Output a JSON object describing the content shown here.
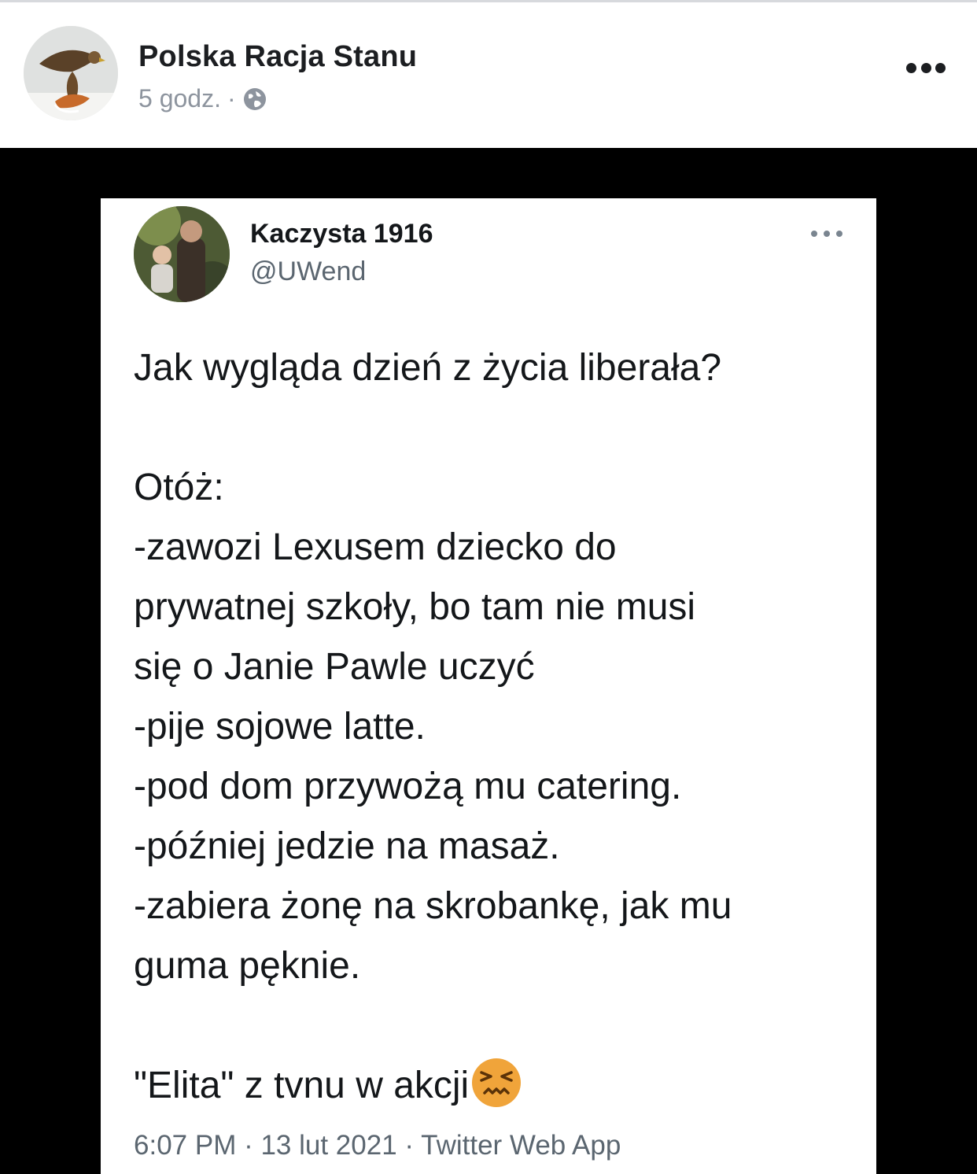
{
  "post": {
    "author": "Polska Racja Stanu",
    "time": "5 godz.",
    "separator": "·",
    "audience_icon": "globe-icon",
    "more_icon": "more-horizontal-icon"
  },
  "tweet": {
    "display_name": "Kaczysta 1916",
    "handle": "@UWend",
    "lines": [
      "Jak wygląda dzień z życia liberała?",
      "",
      "Otóż:",
      "-zawozi Lexusem dziecko do",
      "prywatnej szkoły, bo tam nie musi",
      "się o Janie Pawle uczyć",
      "-pije sojowe latte.",
      "-pod dom przywożą mu catering.",
      "-później jedzie na masaż.",
      "-zabiera żonę na skrobankę, jak mu",
      "guma pęknie.",
      "",
      "\"Elita\" z tvnu w akcji"
    ],
    "emoji_icon": "confounded-face-icon",
    "footer": "6:07 PM · 13 lut 2021 · Twitter Web App"
  },
  "colors": {
    "name_text": "#1c1e21",
    "meta_text": "#8d949e",
    "tweet_text": "#14171a",
    "tweet_secondary": "#5b6670",
    "image_background": "#000000",
    "emoji": "#f0a43a"
  }
}
